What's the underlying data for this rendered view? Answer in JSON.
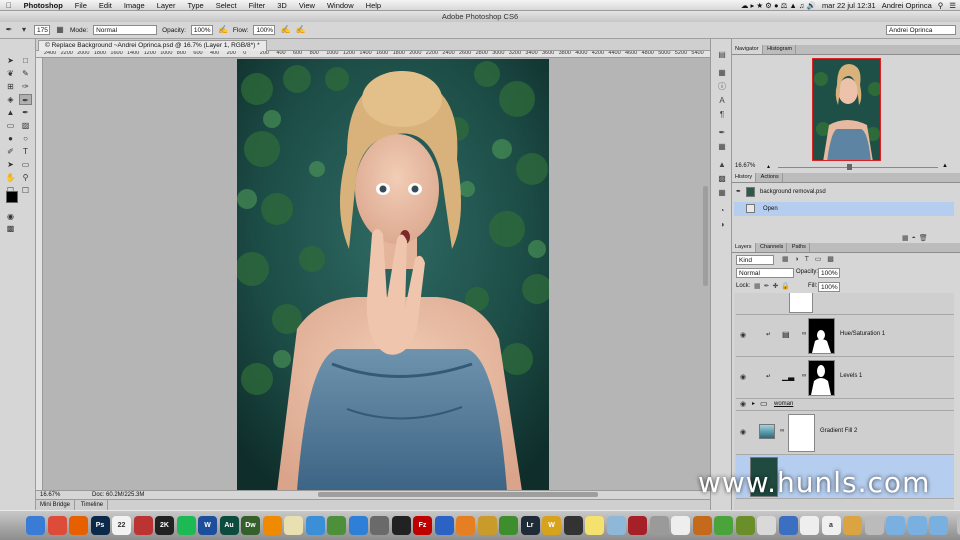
{
  "menubar": {
    "apple_icon": "apple-icon",
    "items": [
      "Photoshop",
      "File",
      "Edit",
      "Image",
      "Layer",
      "Type",
      "Select",
      "Filter",
      "3D",
      "View",
      "Window",
      "Help"
    ],
    "datetime": "mar 22 jul  12:31",
    "user": "Andrei Oprinca"
  },
  "window": {
    "title": "Adobe Photoshop CS6"
  },
  "options_bar": {
    "brush_size": "175",
    "mode_label": "Mode:",
    "mode_value": "Normal",
    "opacity_label": "Opacity:",
    "opacity_value": "100%",
    "flow_label": "Flow:",
    "flow_value": "100%",
    "workspace": "Andrei Oprinca"
  },
  "document": {
    "tab": "© Replace Background ~Andrei Oprinca.psd @ 16.7% (Layer 1, RGB/8*) *",
    "ruler_ticks": [
      "2400",
      "2200",
      "2000",
      "1800",
      "1600",
      "1400",
      "1200",
      "1000",
      "800",
      "600",
      "400",
      "200",
      "0",
      "200",
      "400",
      "600",
      "800",
      "1000",
      "1200",
      "1400",
      "1600",
      "1800",
      "2000",
      "2200",
      "2400",
      "2600",
      "2800",
      "3000",
      "3200",
      "3400",
      "3600",
      "3800",
      "4000",
      "4200",
      "4400",
      "4600",
      "4800",
      "5000",
      "5200",
      "5400"
    ]
  },
  "status": {
    "zoom": "16.67%",
    "doc": "Doc: 60.2M/225.3M"
  },
  "bottom_tabs": [
    "Mini Bridge",
    "Timeline"
  ],
  "navigator": {
    "tabs": [
      "Navigator",
      "Histogram"
    ],
    "zoom": "16.67%"
  },
  "history": {
    "tabs": [
      "History",
      "Actions"
    ],
    "snapshot": "background removal.psd",
    "steps": [
      "Open"
    ]
  },
  "layers": {
    "tabs": [
      "Layers",
      "Channels",
      "Paths"
    ],
    "filter": "Kind",
    "blend_mode": "Normal",
    "opacity_label": "Opacity:",
    "opacity": "100%",
    "lock_label": "Lock:",
    "fill_label": "Fill:",
    "fill": "100%",
    "items": [
      "Hue/Saturation 1",
      "Levels 1",
      "woman",
      "Gradient Fill 2"
    ]
  },
  "watermark": "www.hunls.com",
  "dock": [
    {
      "name": "finder",
      "label": "",
      "color": "#3a7bd5"
    },
    {
      "name": "chrome",
      "label": "",
      "color": "#dd4b39"
    },
    {
      "name": "firefox",
      "label": "",
      "color": "#e66000"
    },
    {
      "name": "photoshop",
      "label": "Ps",
      "color": "#0b2a4a"
    },
    {
      "name": "calendar",
      "label": "22",
      "color": "#f2f2f2"
    },
    {
      "name": "games",
      "label": "",
      "color": "#b33"
    },
    {
      "name": "app-2k",
      "label": "2K",
      "color": "#222"
    },
    {
      "name": "spotify",
      "label": "",
      "color": "#1db954"
    },
    {
      "name": "app-w",
      "label": "W",
      "color": "#1c4e9c"
    },
    {
      "name": "audition",
      "label": "Au",
      "color": "#0e4b3f"
    },
    {
      "name": "dreamweaver",
      "label": "Dw",
      "color": "#35602a"
    },
    {
      "name": "vlc",
      "label": "",
      "color": "#f08a00"
    },
    {
      "name": "notes",
      "label": "",
      "color": "#e8e0b0"
    },
    {
      "name": "safari",
      "label": "",
      "color": "#3b8fd6"
    },
    {
      "name": "drive",
      "label": "",
      "color": "#4d8f3a"
    },
    {
      "name": "app-store",
      "label": "",
      "color": "#2d7fd8"
    },
    {
      "name": "system-prefs",
      "label": "",
      "color": "#6a6a6a"
    },
    {
      "name": "terminal",
      "label": "",
      "color": "#222"
    },
    {
      "name": "filezilla",
      "label": "Fz",
      "color": "#bf0000"
    },
    {
      "name": "app-blue",
      "label": "",
      "color": "#2a63c5"
    },
    {
      "name": "app-orange",
      "label": "",
      "color": "#e67e22"
    },
    {
      "name": "app-gold",
      "label": "",
      "color": "#c89b2b"
    },
    {
      "name": "app-green",
      "label": "",
      "color": "#3e8e2e"
    },
    {
      "name": "lightroom",
      "label": "Lr",
      "color": "#1f2c38"
    },
    {
      "name": "app-w2",
      "label": "W",
      "color": "#d7a31c"
    },
    {
      "name": "app-dark",
      "label": "",
      "color": "#333"
    },
    {
      "name": "stickies",
      "label": "",
      "color": "#f4e16e"
    },
    {
      "name": "preview",
      "label": "",
      "color": "#8fb7d8"
    },
    {
      "name": "photo-booth",
      "label": "",
      "color": "#a62028"
    },
    {
      "name": "app-gray",
      "label": "",
      "color": "#9a9a9a"
    },
    {
      "name": "textedit",
      "label": "",
      "color": "#eee"
    },
    {
      "name": "tools",
      "label": "",
      "color": "#c46a1a"
    },
    {
      "name": "app-green2",
      "label": "",
      "color": "#4aa33b"
    },
    {
      "name": "app-lines",
      "label": "",
      "color": "#6a8f2a"
    },
    {
      "name": "app-light",
      "label": "",
      "color": "#d9d9d9"
    },
    {
      "name": "app-blue2",
      "label": "",
      "color": "#3a6fc2"
    },
    {
      "name": "app-light2",
      "label": "",
      "color": "#eeeeee"
    },
    {
      "name": "signature",
      "label": "a",
      "color": "#f0f0f0"
    },
    {
      "name": "folder-1",
      "label": "",
      "color": "#d9a441"
    },
    {
      "name": "folder-2",
      "label": "",
      "color": "#bbb"
    },
    {
      "name": "folder-3",
      "label": "",
      "color": "#7ab0e0"
    },
    {
      "name": "folder-4",
      "label": "",
      "color": "#7ab0e0"
    },
    {
      "name": "folder-5",
      "label": "",
      "color": "#7ab0e0"
    },
    {
      "name": "trash",
      "label": "",
      "color": "#c0c0c0"
    }
  ]
}
